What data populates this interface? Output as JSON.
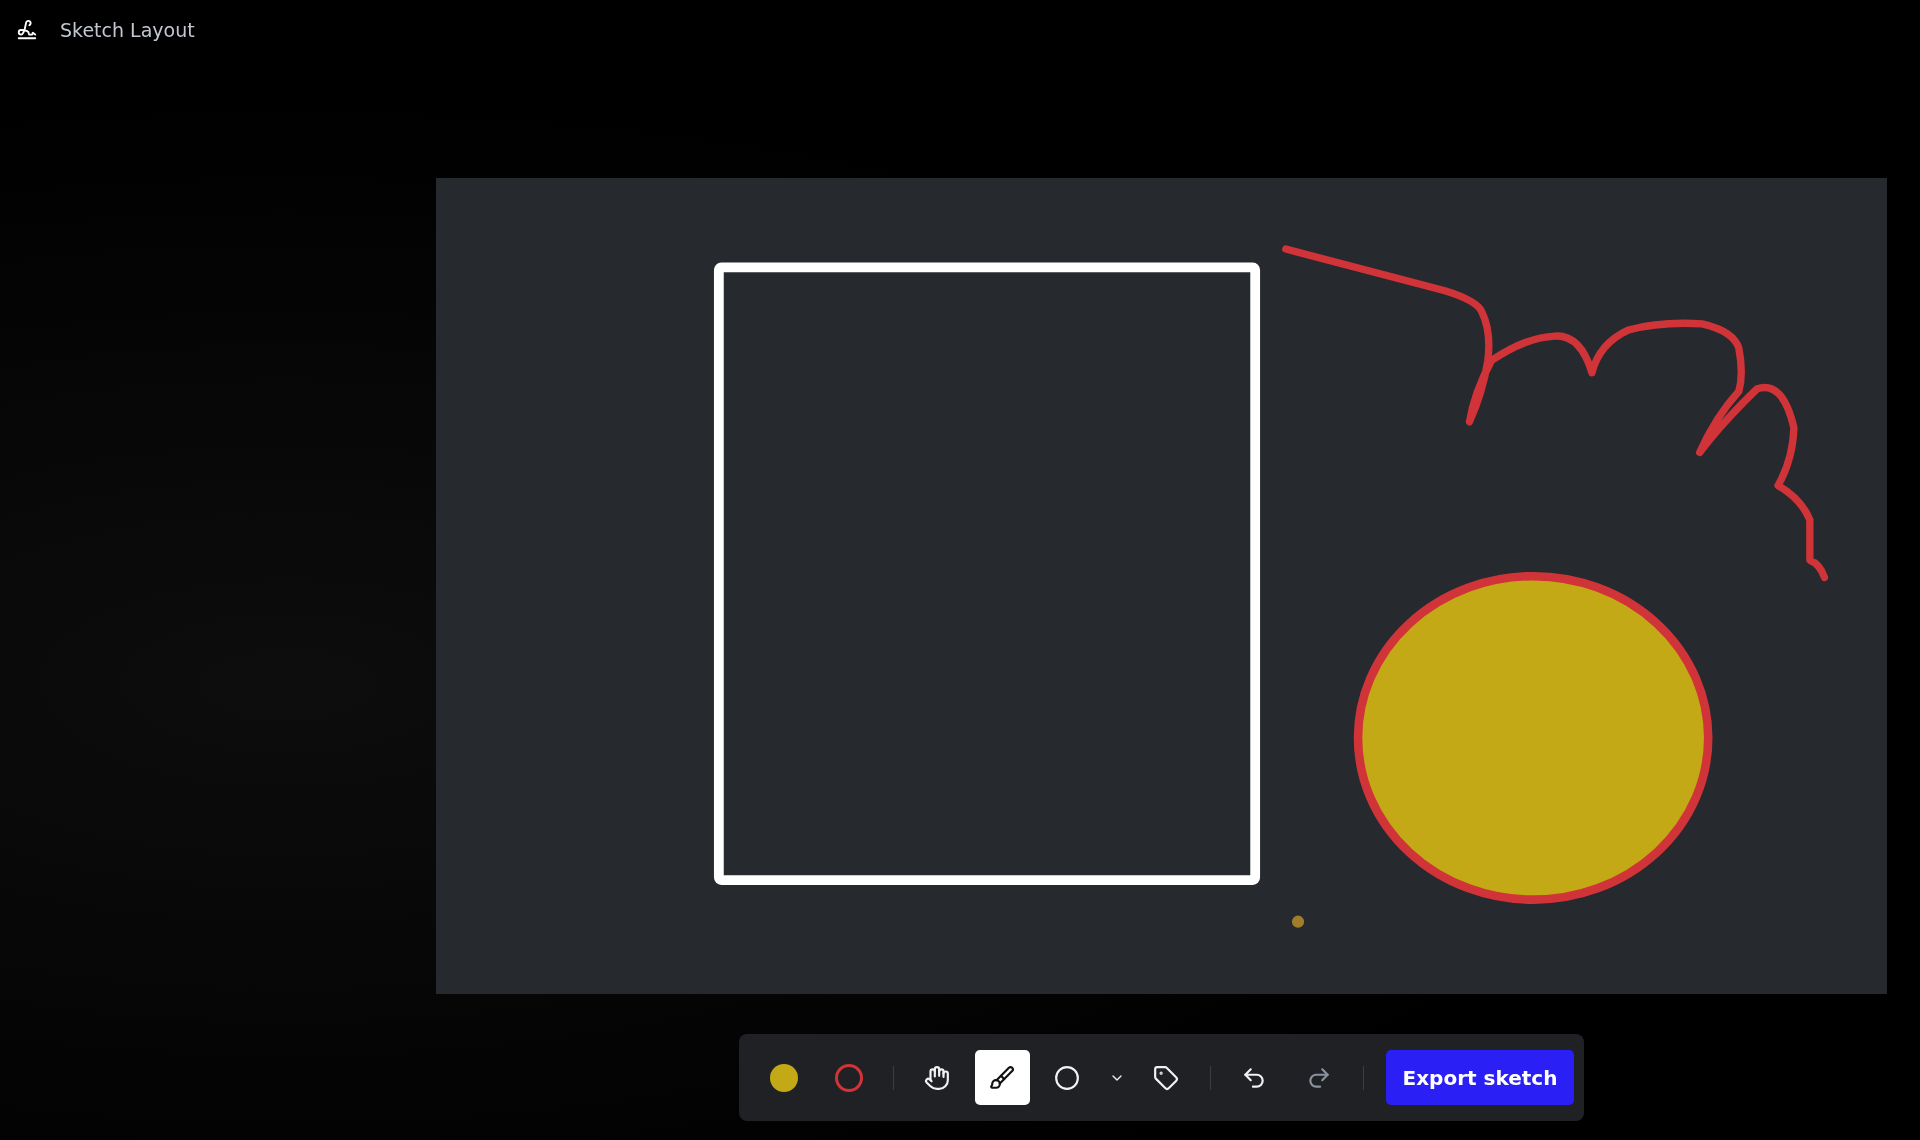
{
  "header": {
    "title": "Sketch Layout"
  },
  "toolbar": {
    "items": [
      {
        "kind": "fill-swatch",
        "color": "#c4a916"
      },
      {
        "kind": "stroke-swatch",
        "color": "#d13438"
      },
      {
        "kind": "divider"
      },
      {
        "kind": "hand",
        "selected": false
      },
      {
        "kind": "brush",
        "selected": true
      },
      {
        "kind": "ellipse",
        "selected": false
      },
      {
        "kind": "shape-menu"
      },
      {
        "kind": "tag",
        "selected": false
      },
      {
        "kind": "divider"
      },
      {
        "kind": "undo",
        "disabled": false
      },
      {
        "kind": "redo",
        "disabled": true
      },
      {
        "kind": "divider"
      },
      {
        "kind": "export",
        "label": "Export sketch"
      }
    ]
  }
}
